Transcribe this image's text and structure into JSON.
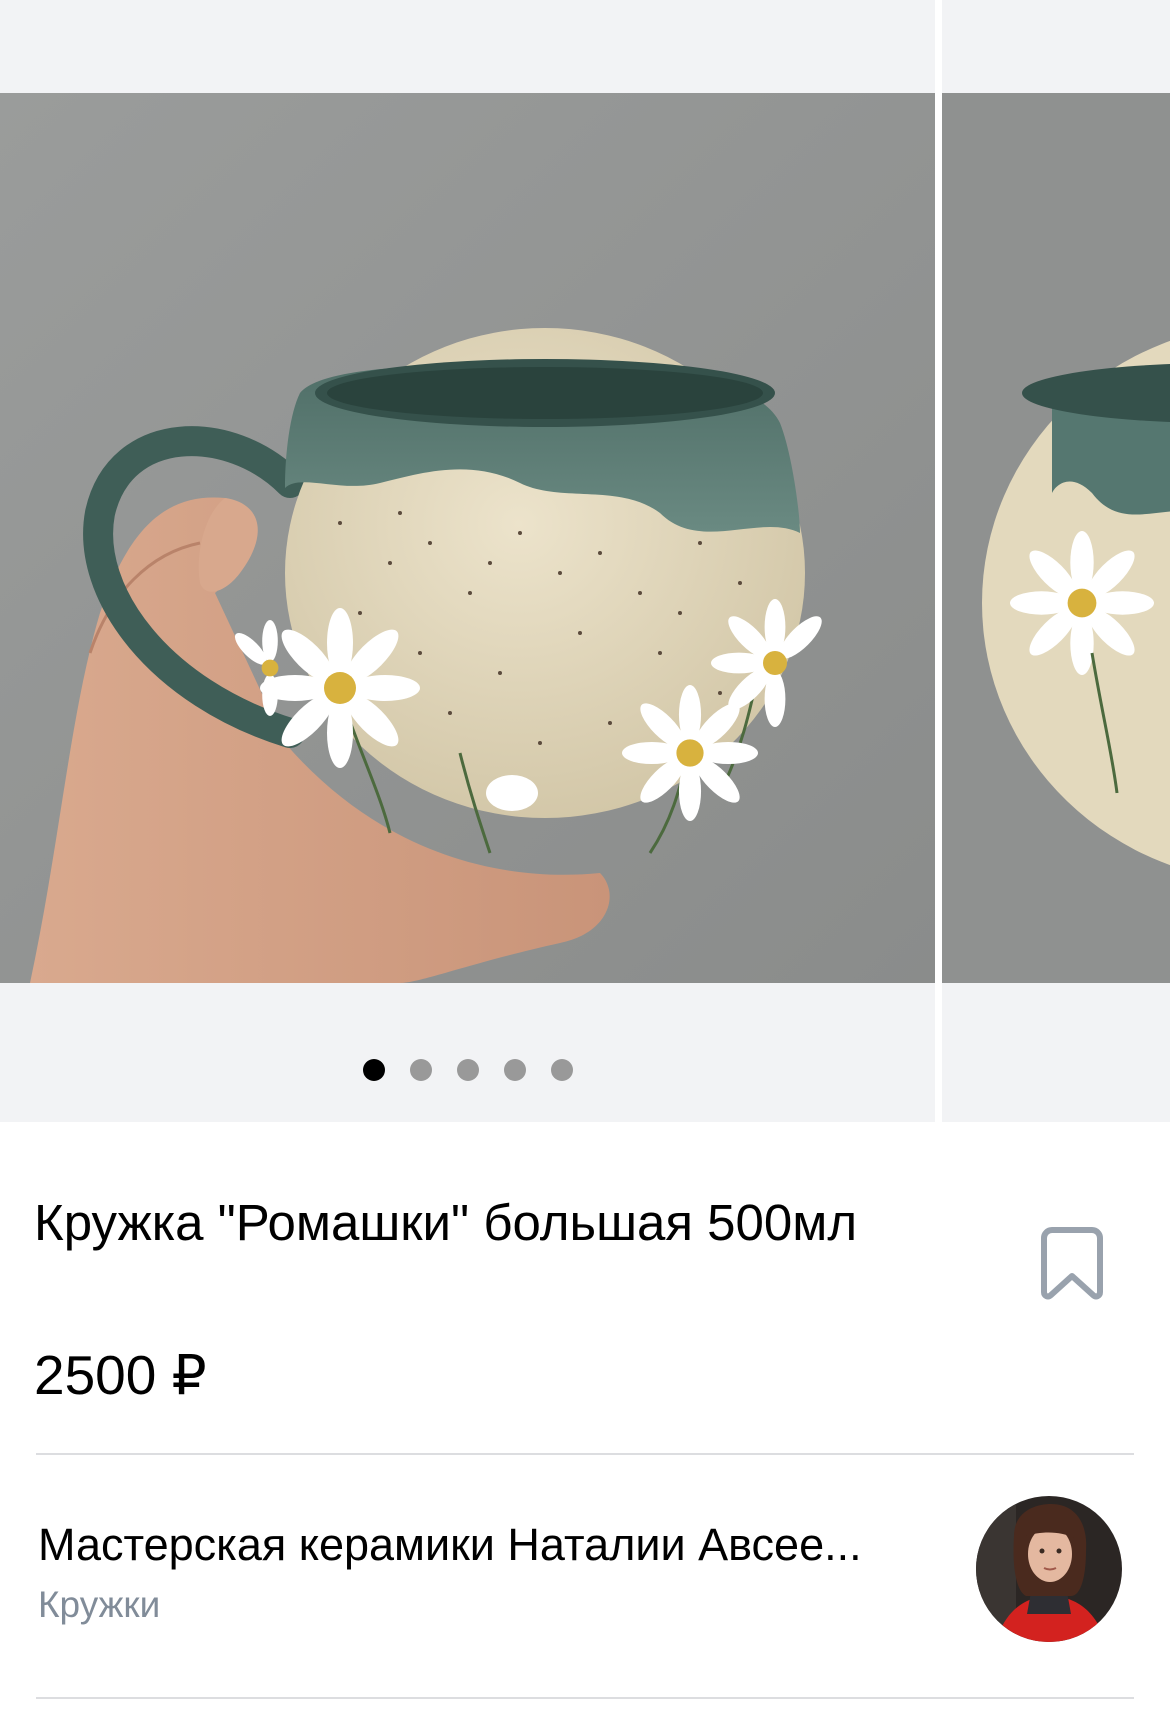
{
  "gallery": {
    "photo_count": 5,
    "active_index": 0
  },
  "product": {
    "title": "Кружка \"Ромашки\" большая 500мл",
    "price": "2500 ₽",
    "bookmark_icon": "bookmark-icon"
  },
  "shop": {
    "name": "Мастерская керамики Наталии Авсее...",
    "category": "Кружки"
  },
  "colors": {
    "background": "#ffffff",
    "gallery_bg": "#f2f3f5",
    "dot_active": "#000000",
    "dot_inactive": "#999999",
    "secondary_text": "#818c99",
    "separator": "#dcdde0"
  }
}
